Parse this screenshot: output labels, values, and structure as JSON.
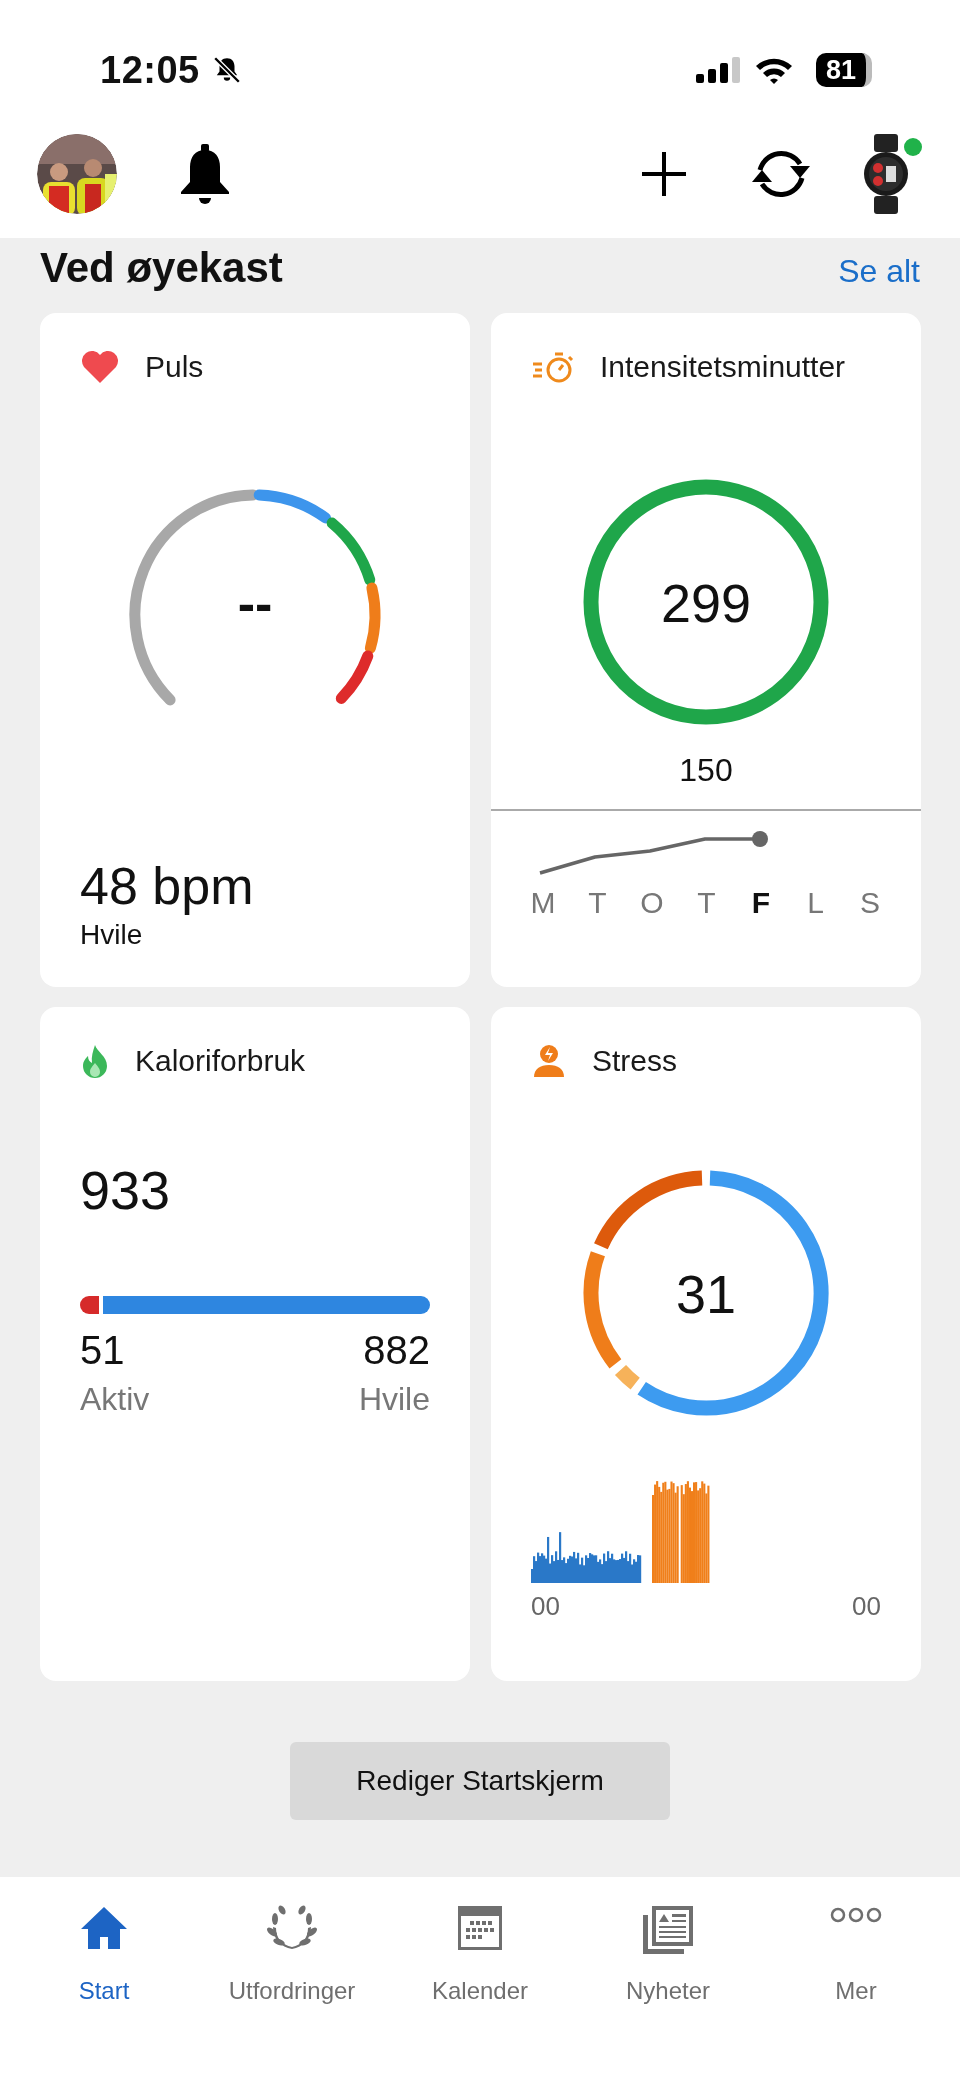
{
  "status_bar": {
    "time": "12:05",
    "battery": "81"
  },
  "section": {
    "title": "Ved øyekast",
    "link": "Se alt"
  },
  "cards": [
    {
      "kind": "heart_rate",
      "title": "Puls",
      "value": "--",
      "reading": "48 bpm",
      "caption": "Hvile"
    },
    {
      "kind": "intensity",
      "title": "Intensitetsminutter",
      "value": "299",
      "goal": "150",
      "days": [
        {
          "label": "M",
          "selected": false
        },
        {
          "label": "T",
          "selected": false
        },
        {
          "label": "O",
          "selected": false
        },
        {
          "label": "T",
          "selected": false
        },
        {
          "label": "F",
          "selected": true
        },
        {
          "label": "L",
          "selected": false
        },
        {
          "label": "S",
          "selected": false
        }
      ]
    },
    {
      "kind": "calories",
      "title": "Kaloriforbruk",
      "total": "933",
      "level": 0.055,
      "active": "51",
      "active_label": "Aktiv",
      "resting": "882",
      "resting_label": "Hvile"
    },
    {
      "kind": "stress",
      "title": "Stress",
      "value": "31",
      "axis_start": "00",
      "axis_end": "00"
    }
  ],
  "edit_button": "Rediger Startskjerm",
  "nav": [
    {
      "label": "Start",
      "selected": true
    },
    {
      "label": "Utfordringer",
      "selected": false
    },
    {
      "label": "Kalender",
      "selected": false
    },
    {
      "label": "Nyheter",
      "selected": false
    },
    {
      "label": "Mer",
      "selected": false
    }
  ]
}
